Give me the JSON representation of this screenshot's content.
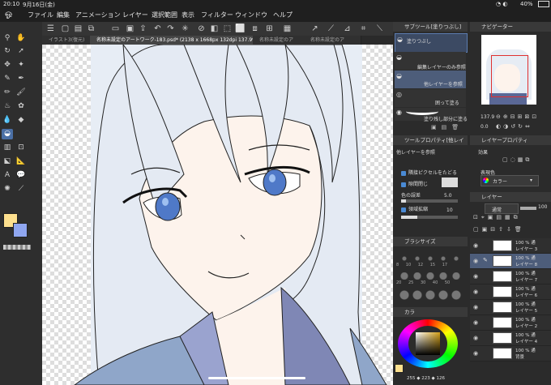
{
  "status": {
    "time": "20:10",
    "date": "9月16日(金)",
    "battery": "40%"
  },
  "menu": [
    "ファイル",
    "編集",
    "アニメーション",
    "レイヤー",
    "選択範囲",
    "表示",
    "フィルター",
    "ウィンドウ",
    "ヘルプ"
  ],
  "tabs": [
    "イラスト3(復元)",
    "名称未設定のアートワーク-183.psd* (2138 x 1668px 132dpi 137.9%)",
    "名称未設定のア",
    "名称未設定のア"
  ],
  "sub_tool_panel": {
    "title": "サブツール[塗りつぶし]",
    "items": [
      "塗りつぶし",
      "編集レイヤーのみ参照",
      "他レイヤーを参照",
      "囲って塗る",
      "塗り残し部分に塗る"
    ]
  },
  "navigator": {
    "title": "ナビゲーター",
    "zoom": "137.9",
    "angle": "0.0"
  },
  "tool_property": {
    "title": "ツールプロパティ[他レイ",
    "subtitle": "他レイヤーを参照",
    "options": [
      "隣接ピクセルをたどる",
      "隙間閉じ"
    ],
    "color_margin_label": "色の誤差",
    "color_margin_value": "5.0",
    "expand_label": "領域拡縮",
    "expand_value": "10"
  },
  "layer_property": {
    "title": "レイヤープロパティ",
    "effect_label": "効果",
    "expression_label": "表現色",
    "expression_value": "カラー"
  },
  "brush_size": {
    "title": "ブラシサイズ",
    "sizes": [
      "8",
      "10",
      "12",
      "15",
      "17",
      "20",
      "25",
      "30",
      "40",
      "50"
    ]
  },
  "color_panel": {
    "title": "カラ",
    "rgb": "255 ◆ 223 ◆ 126"
  },
  "layer_panel": {
    "title": "レイヤー",
    "blend": "通常",
    "opacity": "100",
    "layers": [
      {
        "pct": "100 % 通",
        "name": "レイヤー 3"
      },
      {
        "pct": "100 % 通",
        "name": "レイヤー 8"
      },
      {
        "pct": "100 % 通",
        "name": "レイヤー 7"
      },
      {
        "pct": "100 % 通",
        "name": "レイヤー 6"
      },
      {
        "pct": "100 % 通",
        "name": "レイヤー 5"
      },
      {
        "pct": "100 % 通",
        "name": "レイヤー 2"
      },
      {
        "pct": "100 % 通",
        "name": "レイヤー 4"
      },
      {
        "pct": "100 % 通",
        "name": "背景"
      }
    ]
  },
  "colors": {
    "main": "#fde08e",
    "sub": "#8fa6f0",
    "accent": "#4a8ad4"
  }
}
